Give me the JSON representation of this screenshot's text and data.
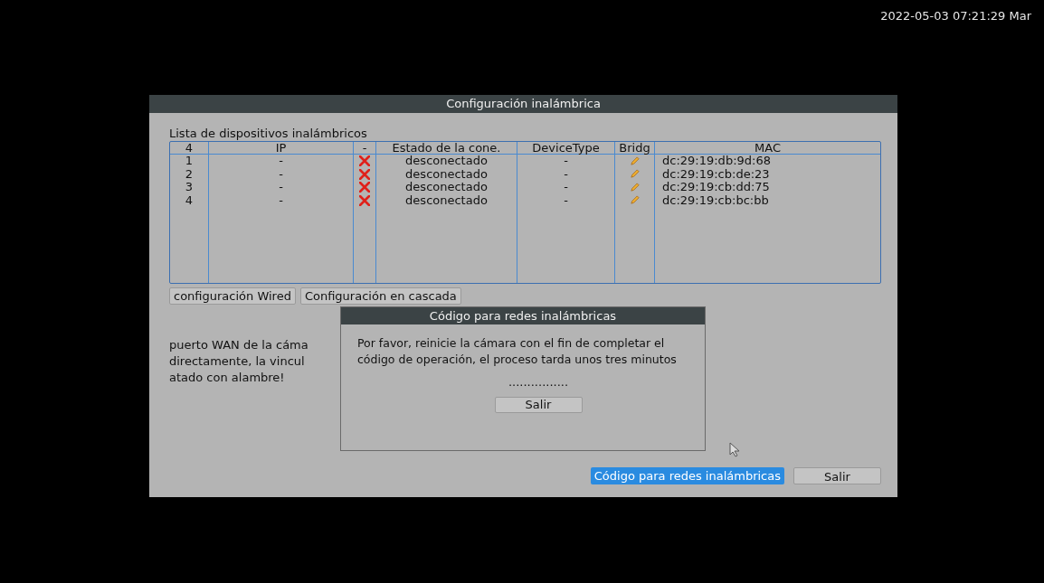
{
  "clock": "2022-05-03 07:21:29 Mar",
  "window": {
    "title": "Configuración inalámbrica"
  },
  "device_list": {
    "label": "Lista de dispositivos inalámbricos",
    "columns": [
      "4",
      "IP",
      "-",
      "Estado de la cone.",
      "DeviceType",
      "Bridg",
      "MAC"
    ],
    "rows": [
      {
        "index": "1",
        "ip": "-",
        "connected": false,
        "status": "desconectado",
        "device_type": "-",
        "mac": "dc:29:19:db:9d:68"
      },
      {
        "index": "2",
        "ip": "-",
        "connected": false,
        "status": "desconectado",
        "device_type": "-",
        "mac": "dc:29:19:cb:de:23"
      },
      {
        "index": "3",
        "ip": "-",
        "connected": false,
        "status": "desconectado",
        "device_type": "-",
        "mac": "dc:29:19:cb:dd:75"
      },
      {
        "index": "4",
        "ip": "-",
        "connected": false,
        "status": "desconectado",
        "device_type": "-",
        "mac": "dc:29:19:cb:bc:bb"
      }
    ]
  },
  "tabs": [
    {
      "label": "configuración Wired",
      "selected": false
    },
    {
      "label": "Configuración en cascada",
      "selected": false
    }
  ],
  "note_lines": [
    "puerto WAN de la cáma",
    "directamente, la vincul",
    "atado con alambre!"
  ],
  "buttons": [
    {
      "label": "Código para redes inalámbricas",
      "selected": true
    },
    {
      "label": "Salir",
      "selected": false
    }
  ],
  "dialog": {
    "title": "Código para redes inalámbricas",
    "message": "Por favor, reinicie la cámara con el fin de completar el código de operación, el proceso tarda unos tres minutos",
    "progress": "................",
    "button": "Salir"
  }
}
